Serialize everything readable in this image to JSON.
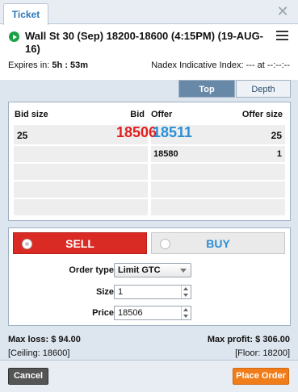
{
  "tabs": {
    "ticket": "Ticket"
  },
  "header": {
    "title": "Wall St 30 (Sep) 18200-18600 (4:15PM) (19-AUG-16)",
    "expires_label": "Expires in:",
    "expires_value": "5h : 53m",
    "nadex_index": "Nadex Indicative Index: --- at --:--:--"
  },
  "view_toggle": {
    "top": "Top",
    "depth": "Depth",
    "selected": "Top"
  },
  "order_book": {
    "headers": {
      "bid_size": "Bid size",
      "bid": "Bid",
      "offer": "Offer",
      "offer_size": "Offer size"
    },
    "bids": [
      {
        "size": "25",
        "price": "18506"
      }
    ],
    "offers": [
      {
        "price": "18511",
        "size": "25"
      },
      {
        "price": "18580",
        "size": "1"
      }
    ]
  },
  "order_form": {
    "sell_label": "SELL",
    "buy_label": "BUY",
    "selected_side": "SELL",
    "order_type_label": "Order type",
    "order_type_value": "Limit GTC",
    "size_label": "Size",
    "size_value": "1",
    "price_label": "Price",
    "price_value": "18506"
  },
  "risk": {
    "max_loss_label": "Max loss:",
    "max_loss_value": "$ 94.00",
    "ceiling": "[Ceiling: 18600]",
    "max_profit_label": "Max profit:",
    "max_profit_value": "$ 306.00",
    "floor": "[Floor: 18200]"
  },
  "footer": {
    "cancel": "Cancel",
    "place_order": "Place Order"
  },
  "colors": {
    "sell": "#d92b24",
    "buy_text": "#2a8fd6",
    "bid_price": "#e02020",
    "offer_price": "#2a8fd6",
    "place_order": "#f07d1a",
    "selected_tab": "#6888a8"
  },
  "icons": {
    "close": "close-icon",
    "menu": "menu-icon",
    "status": "play-icon"
  }
}
